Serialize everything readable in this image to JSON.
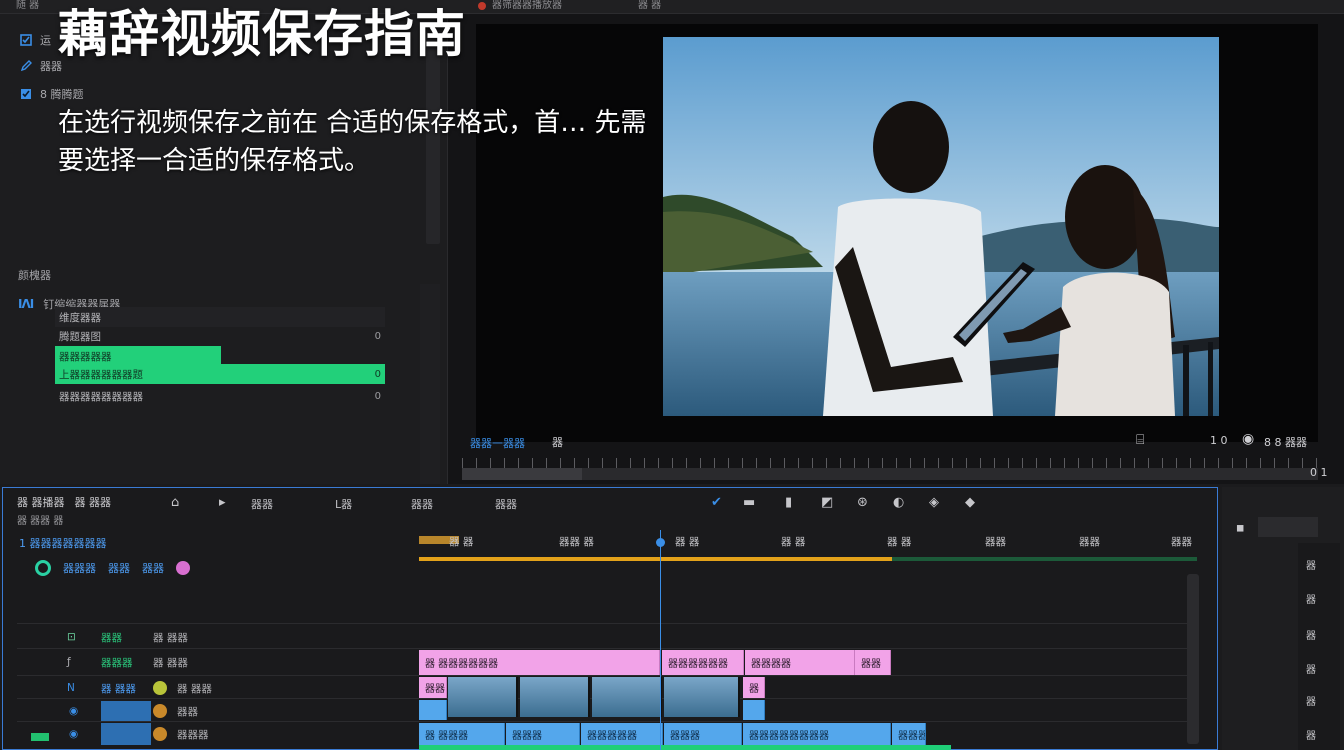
{
  "overlay": {
    "title": "藕辞视频保存指南",
    "subtitle": "在选行视频保存之前在 合适的保存格式，首… 先需要选择一合适的保存格式。"
  },
  "topbar": {
    "left_label": "随 器",
    "mid_label": "器筛器器播放器",
    "right_label": "器 器"
  },
  "effects_panel": {
    "rows": [
      {
        "icon": "checkbox-icon",
        "label": "运"
      },
      {
        "icon": "pen-icon",
        "label": "器器"
      },
      {
        "icon": "checkbox-icon",
        "label": "8 腾腾题"
      }
    ],
    "section_title": "颜槐器",
    "wave_label": "钉缩缩器器属器",
    "properties": [
      {
        "label": "维度器器",
        "value": "",
        "style": "dark"
      },
      {
        "label": "腾题器图",
        "value": "0",
        "style": "plain"
      },
      {
        "label": "器器器器器",
        "value": "",
        "style": "green-short"
      },
      {
        "label": "上器器器器器器题",
        "value": "0",
        "style": "green"
      },
      {
        "label": "器器器器器器器器",
        "value": "0",
        "style": "plain"
      }
    ]
  },
  "monitor": {
    "zoom_label": "器器一器器",
    "left_icon": "器",
    "right_labels": [
      "1 0",
      "8 8 器器"
    ],
    "end_marker": "0 1"
  },
  "timeline": {
    "header_title": "器 器播器",
    "header_title2": "器 器器",
    "header_sub": "器 器器 器",
    "tools": [
      "器器",
      "L器",
      "器器",
      "器器"
    ],
    "sequence_name": "1 器器器器器器器",
    "seq_tools": [
      "器器器",
      "器器",
      "器器"
    ],
    "timecodes": [
      "器 器",
      "器器 器",
      "器 器",
      "器 器",
      "器 器",
      "器器",
      "器器",
      "器器"
    ],
    "tracks": [
      {
        "name": "器器",
        "sub": "器 器器"
      },
      {
        "name": "器器器",
        "sub": "器 器器"
      },
      {
        "name": "器 器器",
        "sub": "器 器器"
      },
      {
        "name": "器器",
        "sub": "器器"
      },
      {
        "name": "器器器",
        "sub": "器器器"
      }
    ],
    "clips": {
      "pink1": "器 器器器器器器",
      "pink2": "器器器器器器",
      "pink3": "器器器器",
      "pink4": "器器",
      "small1": "器器",
      "small2": "器",
      "blue1": "器 器器器",
      "blue2": "器器器",
      "blue3": "器器器器器",
      "blue4": "器器器",
      "blue5": "器器器器器器器器",
      "blue6": "器器器器",
      "blue7": "器器器"
    }
  },
  "right_panel": {
    "icons": [
      "器",
      "器",
      "器",
      "器",
      "器",
      "器"
    ]
  },
  "colors": {
    "accent_blue": "#3a8ee6",
    "clip_pink": "#f2a3e8",
    "clip_blue": "#54a7ec",
    "clip_green": "#1fcf78",
    "highlight_green": "#22d07a",
    "work_area_yellow": "#e3a21a"
  }
}
